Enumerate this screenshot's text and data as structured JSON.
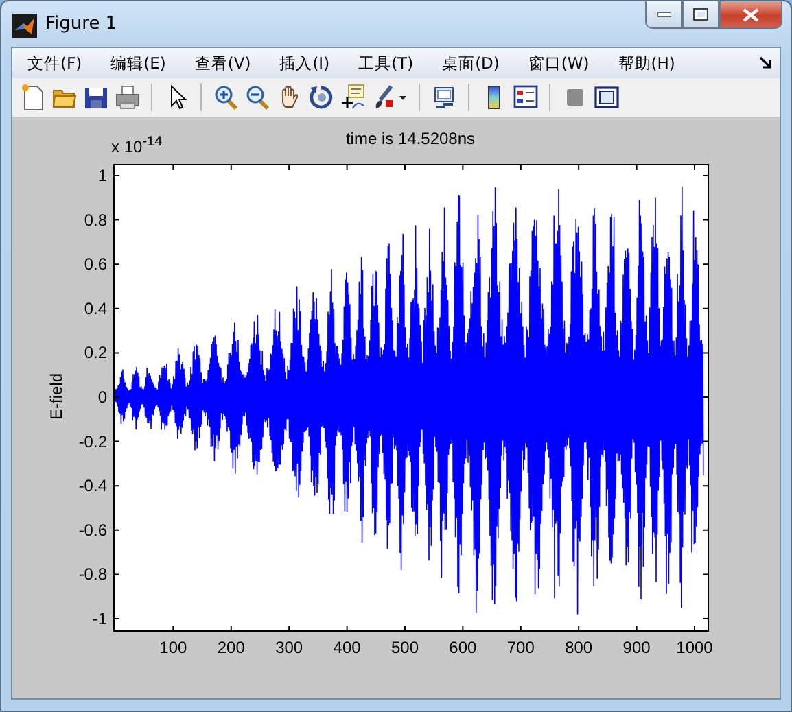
{
  "window": {
    "title": "Figure 1"
  },
  "menu": [
    {
      "label": "文件(F)"
    },
    {
      "label": "编辑(E)"
    },
    {
      "label": "查看(V)"
    },
    {
      "label": "插入(I)"
    },
    {
      "label": "工具(T)"
    },
    {
      "label": "桌面(D)"
    },
    {
      "label": "窗口(W)"
    },
    {
      "label": "帮助(H)"
    }
  ],
  "toolbar": [
    {
      "kind": "new"
    },
    {
      "kind": "open"
    },
    {
      "kind": "save"
    },
    {
      "kind": "print"
    },
    {
      "kind": "sep"
    },
    {
      "kind": "pointer"
    },
    {
      "kind": "sep"
    },
    {
      "kind": "zoomin"
    },
    {
      "kind": "zoomout"
    },
    {
      "kind": "pan"
    },
    {
      "kind": "rotate"
    },
    {
      "kind": "cursor"
    },
    {
      "kind": "brush"
    },
    {
      "kind": "sep"
    },
    {
      "kind": "link"
    },
    {
      "kind": "sep"
    },
    {
      "kind": "colorbar"
    },
    {
      "kind": "legend"
    },
    {
      "kind": "sep"
    },
    {
      "kind": "hide"
    },
    {
      "kind": "tools"
    }
  ],
  "axes": {
    "title": "time is 14.5208ns",
    "exponent": "x 10$^{-14}$",
    "ylabel": "E-field",
    "yticks": [
      "1",
      "0.8",
      "0.6",
      "0.4",
      "0.2",
      "0",
      "-0.2",
      "-0.4",
      "-0.6",
      "-0.8",
      "-1"
    ],
    "xticks": [
      "100",
      "200",
      "300",
      "400",
      "500",
      "600",
      "700",
      "800",
      "900",
      "1000"
    ]
  }
}
